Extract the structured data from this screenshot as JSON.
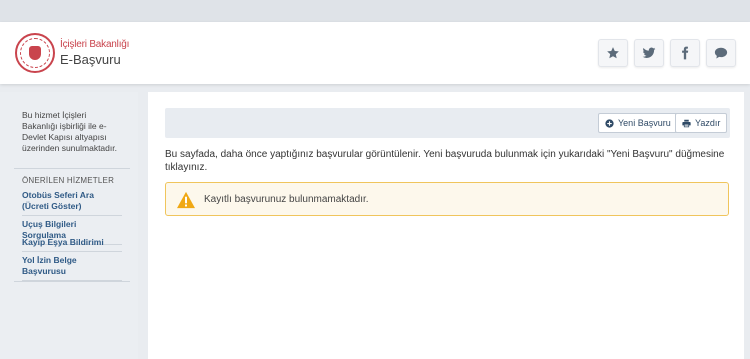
{
  "header": {
    "org_name": "İçişleri Bakanlığı",
    "app_name": "E-Başvuru",
    "socials": [
      {
        "icon": "star-icon",
        "name": "favorite-button"
      },
      {
        "icon": "twitter-icon",
        "name": "twitter-share-button"
      },
      {
        "icon": "facebook-icon",
        "name": "facebook-share-button"
      },
      {
        "icon": "comment-icon",
        "name": "comment-button"
      }
    ]
  },
  "sidebar": {
    "intro": "Bu hizmet İçişleri Bakanlığı işbirliği ile e-Devlet Kapısı altyapısı üzerinden sunulmaktadır.",
    "heading": "ÖNERİLEN HİZMETLER",
    "links": [
      "Otobüs Seferi Ara (Ücreti Göster)",
      "Uçuş Bilgileri Sorgulama",
      "Kayıp Eşya Bildirimi",
      "Yol İzin Belge Başvurusu"
    ]
  },
  "toolbar": {
    "new_label": "Yeni Başvuru",
    "print_label": "Yazdır"
  },
  "main": {
    "info": "Bu sayfada, daha önce yaptığınız başvurular görüntülenir. Yeni başvuruda bulunmak için yukarıdaki \"Yeni Başvuru\" düğmesine tıklayınız.",
    "alert": "Kayıtlı başvurunuz bulunmamaktadır."
  },
  "colors": {
    "brand_red": "#c9444d",
    "link_blue": "#2f5a86",
    "warning": "#f0a814"
  }
}
